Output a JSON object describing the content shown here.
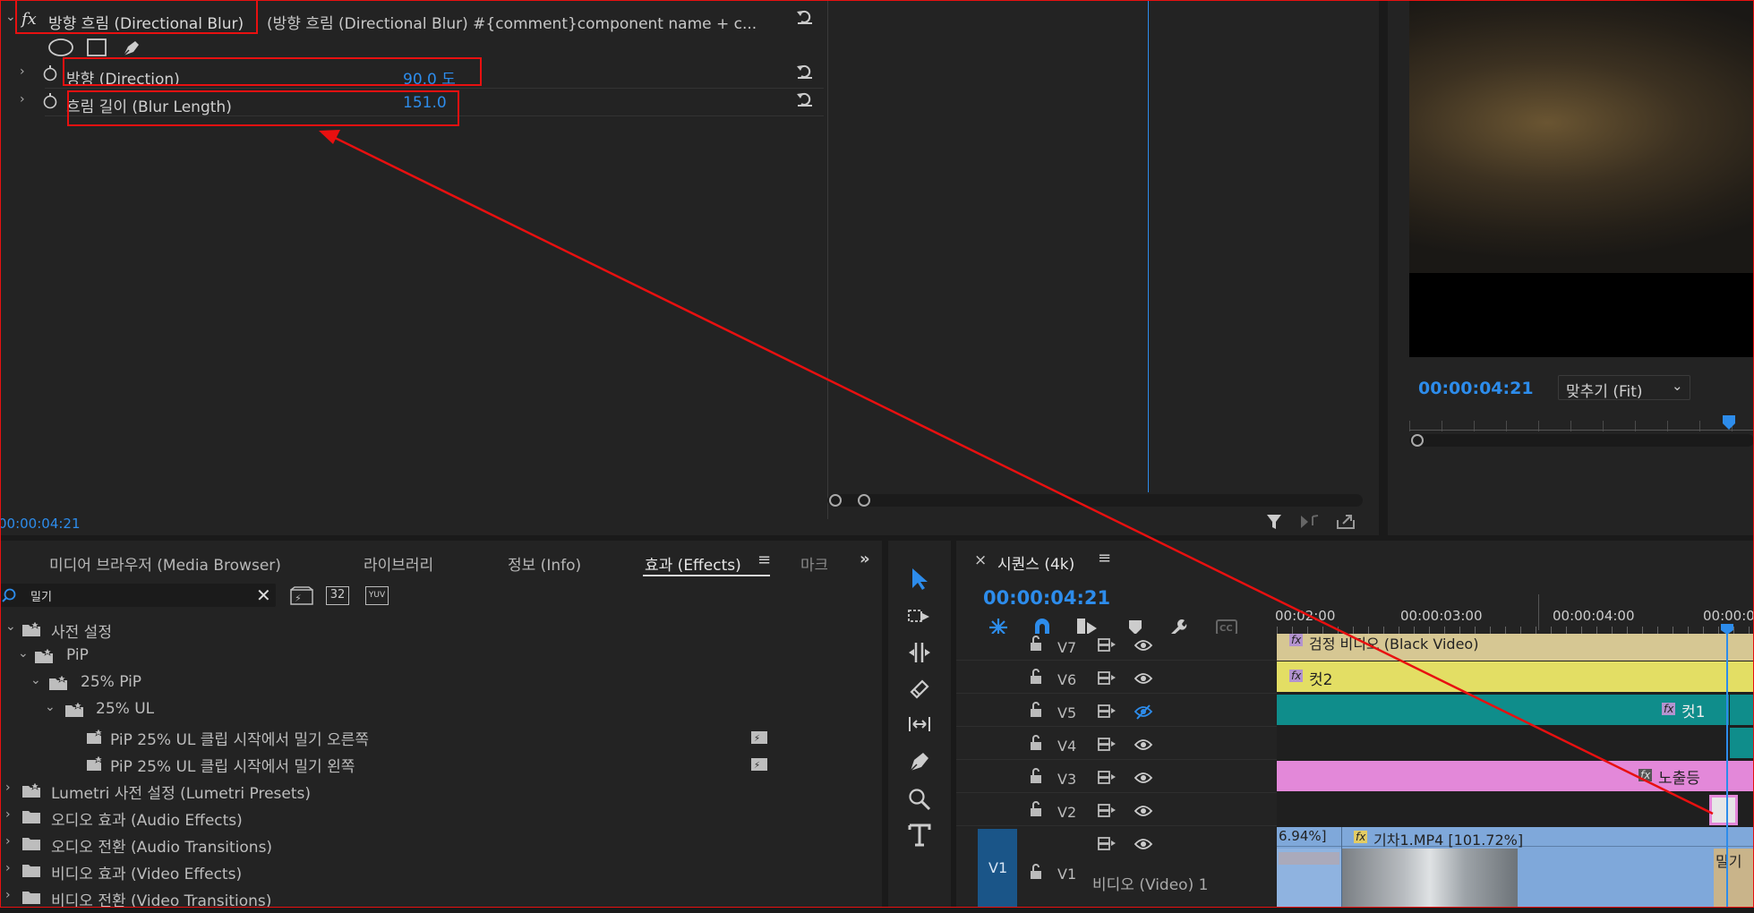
{
  "effect_controls": {
    "effect_name": "방향 흐림 (Directional Blur)",
    "effect_comment": "(방향 흐림 (Directional Blur)  #{comment}component name + c...",
    "fx_label": "fx",
    "params": [
      {
        "label": "방향 (Direction)",
        "value": "90.0 도"
      },
      {
        "label": "흐림 길이 (Blur Length)",
        "value": "151.0"
      }
    ],
    "timecode": "00:00:04:21"
  },
  "program_monitor": {
    "timecode": "00:00:04:21",
    "fit_label": "맞추기 (Fit)"
  },
  "bottom_left": {
    "tabs": [
      "미디어 브라우저 (Media Browser)",
      "라이브러리",
      "정보 (Info)",
      "효과 (Effects)",
      "마크"
    ],
    "active_tab": "효과 (Effects)",
    "search_value": "밀기",
    "badges": [
      "32",
      "YUV"
    ],
    "tree": [
      {
        "label": "사전 설정",
        "level": 0,
        "kind": "preset-folder",
        "open": true
      },
      {
        "label": "PiP",
        "level": 1,
        "kind": "preset-folder",
        "open": true
      },
      {
        "label": "25% PiP",
        "level": 2,
        "kind": "preset-folder",
        "open": true
      },
      {
        "label": "25% UL",
        "level": 3,
        "kind": "preset-folder",
        "open": true
      },
      {
        "label": "PiP 25% UL 클립 시작에서 밀기 오른쪽",
        "level": 4,
        "kind": "preset"
      },
      {
        "label": "PiP 25% UL 클립 시작에서 밀기 왼쪽",
        "level": 4,
        "kind": "preset"
      },
      {
        "label": "Lumetri 사전 설정 (Lumetri Presets)",
        "level": 0,
        "kind": "preset-folder",
        "open": false
      },
      {
        "label": "오디오 효과 (Audio Effects)",
        "level": 0,
        "kind": "folder",
        "open": false
      },
      {
        "label": "오디오 전환 (Audio Transitions)",
        "level": 0,
        "kind": "folder",
        "open": false
      },
      {
        "label": "비디오 효과 (Video Effects)",
        "level": 0,
        "kind": "folder",
        "open": false
      },
      {
        "label": "비디오 전환 (Video Transitions)",
        "level": 0,
        "kind": "folder",
        "open": false
      }
    ]
  },
  "timeline": {
    "close": "×",
    "sequence_name": "시퀀스 (4k)",
    "timecode": "00:00:04:21",
    "ruler": [
      "00:02:00",
      "00:00:03:00",
      "00:00:04:00",
      "00:00:0"
    ],
    "tracks": [
      {
        "name": "V7",
        "hidden": false
      },
      {
        "name": "V6",
        "hidden": false
      },
      {
        "name": "V5",
        "hidden": true
      },
      {
        "name": "V4",
        "hidden": false
      },
      {
        "name": "V3",
        "hidden": false
      },
      {
        "name": "V2",
        "hidden": false
      },
      {
        "name": "V1",
        "hidden": false,
        "source": "V1",
        "label": "비디오 (Video) 1"
      }
    ],
    "clips": {
      "v7": "검정 비디오 (Black Video)",
      "v6": "컷2",
      "v5": "컷1",
      "v3": "노출등",
      "v1_left": "6.94%]",
      "v1_main": "기차1.MP4 [101.72%]",
      "v1_right": "밀기"
    },
    "colors": {
      "yellow": "#e3de64",
      "teal": "#0f8d8b",
      "pink": "#e388d9",
      "blue": "#7fa8da",
      "playhead": "#2d8ceb"
    }
  }
}
